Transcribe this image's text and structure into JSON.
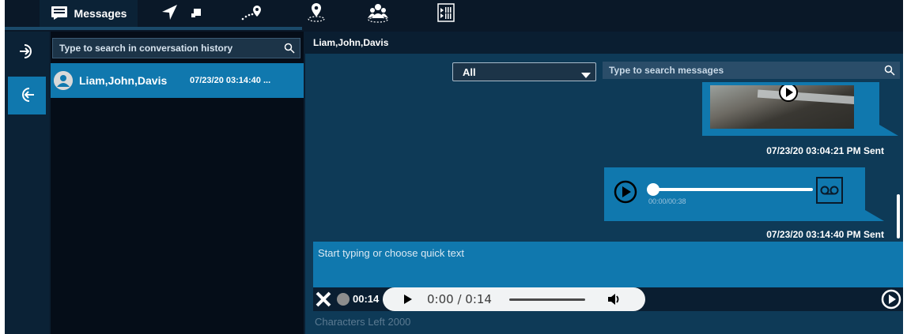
{
  "tabs": [
    {
      "label": "Messages",
      "icon": "messages-icon",
      "active": true
    },
    {
      "icon": "navigate-arrow-icon"
    },
    {
      "icon": "small-square-icon"
    },
    {
      "icon": "route-pin-icon"
    },
    {
      "icon": "location-pin-icon"
    },
    {
      "icon": "group-icon"
    },
    {
      "icon": "media-player-icon"
    }
  ],
  "rail": {
    "items": [
      {
        "icon": "sign-in-icon"
      },
      {
        "icon": "sign-out-icon",
        "active": true
      }
    ]
  },
  "conversations": {
    "search_placeholder": "Type to search in conversation history",
    "items": [
      {
        "name": "Liam,John,Davis",
        "time": "07/23/20 03:14:40 ...",
        "selected": true
      }
    ]
  },
  "chat": {
    "title": "Liam,John,Davis",
    "filter": {
      "selected": "All"
    },
    "search_placeholder": "Type to search messages",
    "messages": [
      {
        "type": "video",
        "timestamp": "07/23/20 03:04:21 PM Sent"
      },
      {
        "type": "audio",
        "duration": "00:00/00:38",
        "progress": 0,
        "timestamp": "07/23/20 03:14:40 PM Sent"
      }
    ]
  },
  "compose": {
    "placeholder": "Start typing or choose quick text",
    "recording_time": "00:14",
    "player_time": "0:00 / 0:14",
    "chars_left": "Characters Left 2000"
  },
  "colors": {
    "accent": "#1078ae",
    "background": "#0b1e31",
    "panel": "#0e3a57"
  }
}
